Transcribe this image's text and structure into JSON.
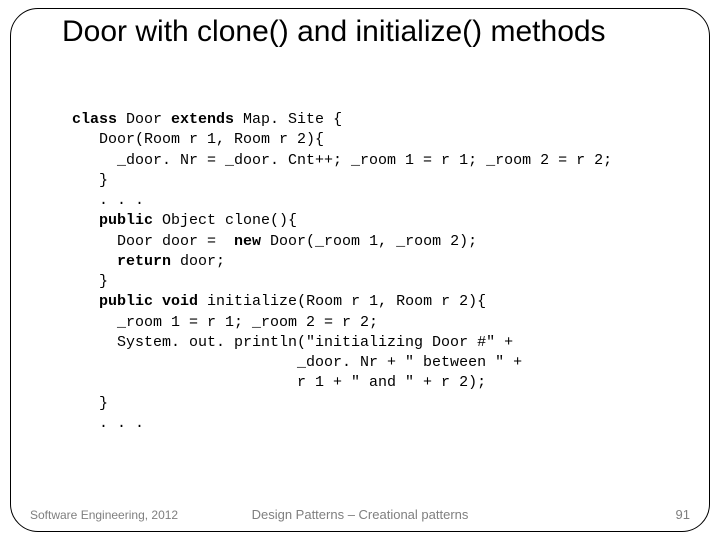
{
  "title": "Door with clone() and initialize() methods",
  "code": {
    "l1a": "class",
    "l1b": " Door ",
    "l1c": "extends",
    "l1d": " Map. Site {",
    "l2": "   Door(Room r 1, Room r 2){",
    "l3": "     _door. Nr = _door. Cnt++; _room 1 = r 1; _room 2 = r 2;",
    "l4": "   }",
    "l5": "   . . .",
    "l6a": "   ",
    "l6b": "public",
    "l6c": " Object clone(){",
    "l7a": "     Door door =  ",
    "l7b": "new",
    "l7c": " Door(_room 1, _room 2);",
    "l8a": "     ",
    "l8b": "return",
    "l8c": " door;",
    "l9": "   }",
    "l10a": "   ",
    "l10b": "public void",
    "l10c": " initialize(Room r 1, Room r 2){",
    "l11": "     _room 1 = r 1; _room 2 = r 2;",
    "l12": "     System. out. println(\"initializing Door #\" +",
    "l13": "                         _door. Nr + \" between \" +",
    "l14": "                         r 1 + \" and \" + r 2);",
    "l15": "   }",
    "l16": "   . . ."
  },
  "footer": {
    "left": "Software Engineering, 2012",
    "center": "Design Patterns – Creational patterns",
    "right": "91"
  }
}
